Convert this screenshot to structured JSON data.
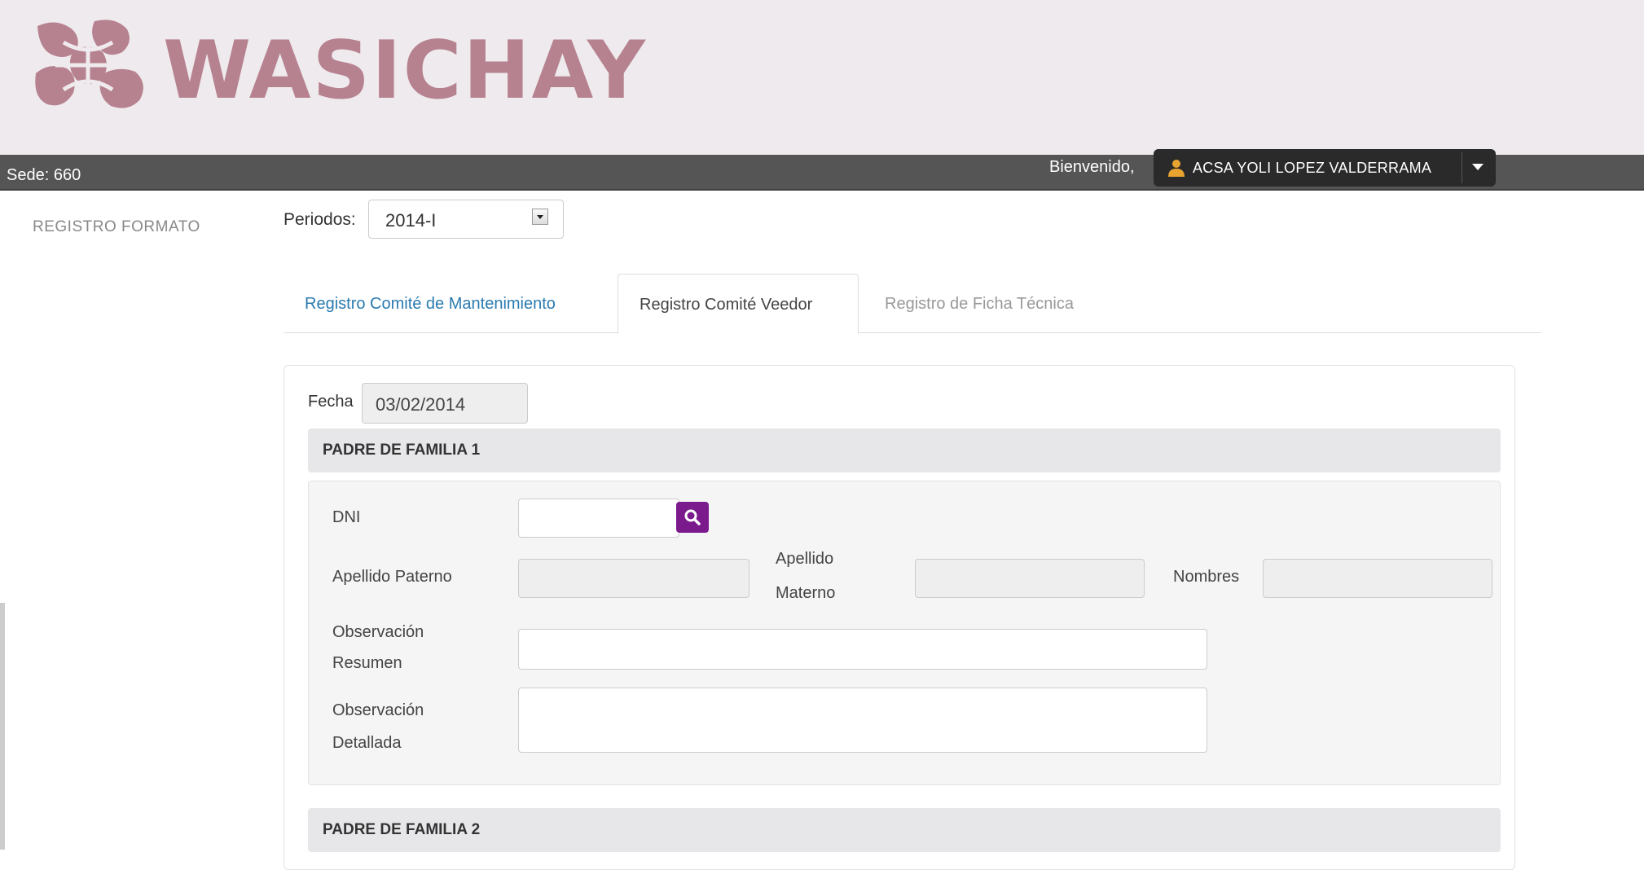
{
  "app": {
    "logo_text": "WASICHAY",
    "brand_color": "#b6828f"
  },
  "topbar": {
    "sede_label": "Sede: 660",
    "welcome_label": "Bienvenido,",
    "user_name": "ACSA YOLI LOPEZ VALDERRAMA",
    "user_icon": "user-icon",
    "dropdown_icon": "caret-down-icon"
  },
  "sidebar": {
    "title": "REGISTRO FORMATO"
  },
  "periodos": {
    "label": "Periodos:",
    "selected": "2014-I"
  },
  "tabs": [
    {
      "label": "Registro Comité de Mantenimiento",
      "state": "link"
    },
    {
      "label": "Registro Comité Veedor",
      "state": "active"
    },
    {
      "label": "Registro de Ficha Técnica",
      "state": "disabled"
    }
  ],
  "form": {
    "fecha_label": "Fecha",
    "fecha_value": "03/02/2014",
    "section_1_title": "PADRE DE FAMILIA 1",
    "section_2_title": "PADRE DE FAMILIA 2",
    "dni_label": "DNI",
    "dni_value": "",
    "search_icon": "search-icon",
    "apellido_paterno_label": "Apellido Paterno",
    "apellido_materno_label_1": "Apellido",
    "apellido_materno_label_2": "Materno",
    "nombres_label": "Nombres",
    "obs_resumen_label_1": "Observación",
    "obs_resumen_label_2": "Resumen",
    "obs_detallada_label_1": "Observación",
    "obs_detallada_label_2": "Detallada"
  },
  "colors": {
    "header_bg": "#efeaed",
    "bar_bg": "#555556",
    "search_button": "#7a1a8c",
    "tab_link": "#2a7bb0"
  }
}
